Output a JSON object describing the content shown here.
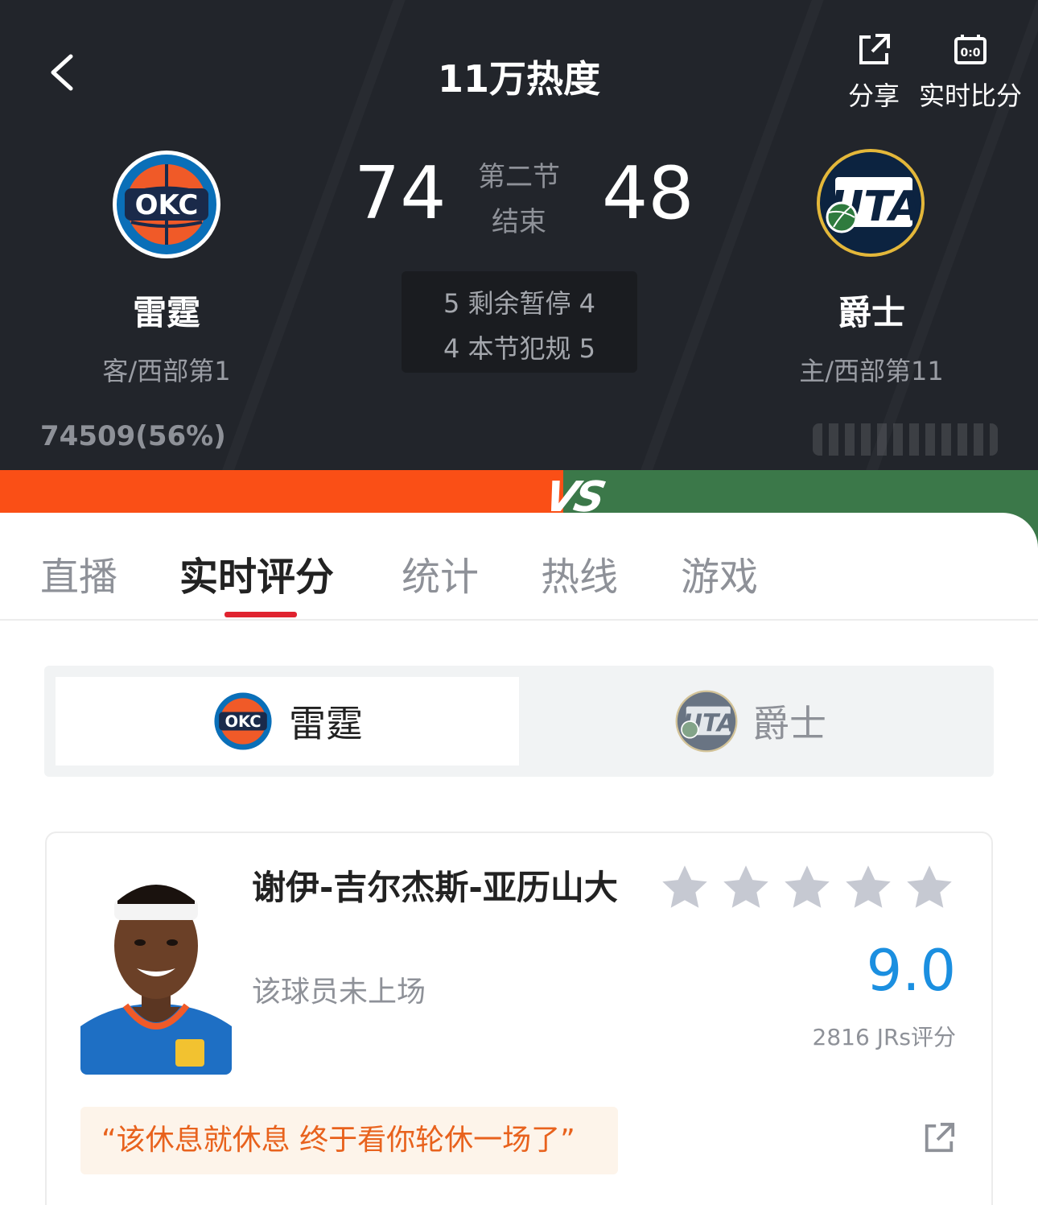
{
  "header": {
    "title": "11万热度",
    "share_label": "分享",
    "live_score_label": "实时比分",
    "live_score_icon_text": "0:0"
  },
  "game": {
    "away": {
      "name": "雷霆",
      "abbr": "OKC",
      "rank": "客/西部第1",
      "score": "74",
      "color": "#007ac1"
    },
    "home": {
      "name": "爵士",
      "abbr": "UTA",
      "rank": "主/西部第11",
      "score": "48",
      "color": "#002b5c"
    },
    "period_line1": "第二节",
    "period_line2": "结束",
    "timeouts_line": "5 剩余暂停 4",
    "fouls_line": "4 本节犯规 5",
    "away_votes": "74509(56%)"
  },
  "vs_text": "VS",
  "colors": {
    "away_bar": "#fa4f16",
    "home_bar": "#3b7849",
    "accent": "#e0232f",
    "rating": "#1b8fe0"
  },
  "tabs": [
    {
      "label": "直播"
    },
    {
      "label": "实时评分"
    },
    {
      "label": "统计"
    },
    {
      "label": "热线"
    },
    {
      "label": "游戏"
    }
  ],
  "active_tab": "实时评分",
  "team_switch": {
    "selected": "雷霆",
    "options": [
      {
        "label": "雷霆"
      },
      {
        "label": "爵士"
      }
    ]
  },
  "player": {
    "name": "谢伊-吉尔杰斯-亚历山大",
    "status": "该球员未上场",
    "stars": 5,
    "rating": "9.0",
    "rating_count": "2816 JRs评分",
    "quote": "“该休息就休息 终于看你轮休一场了”"
  }
}
